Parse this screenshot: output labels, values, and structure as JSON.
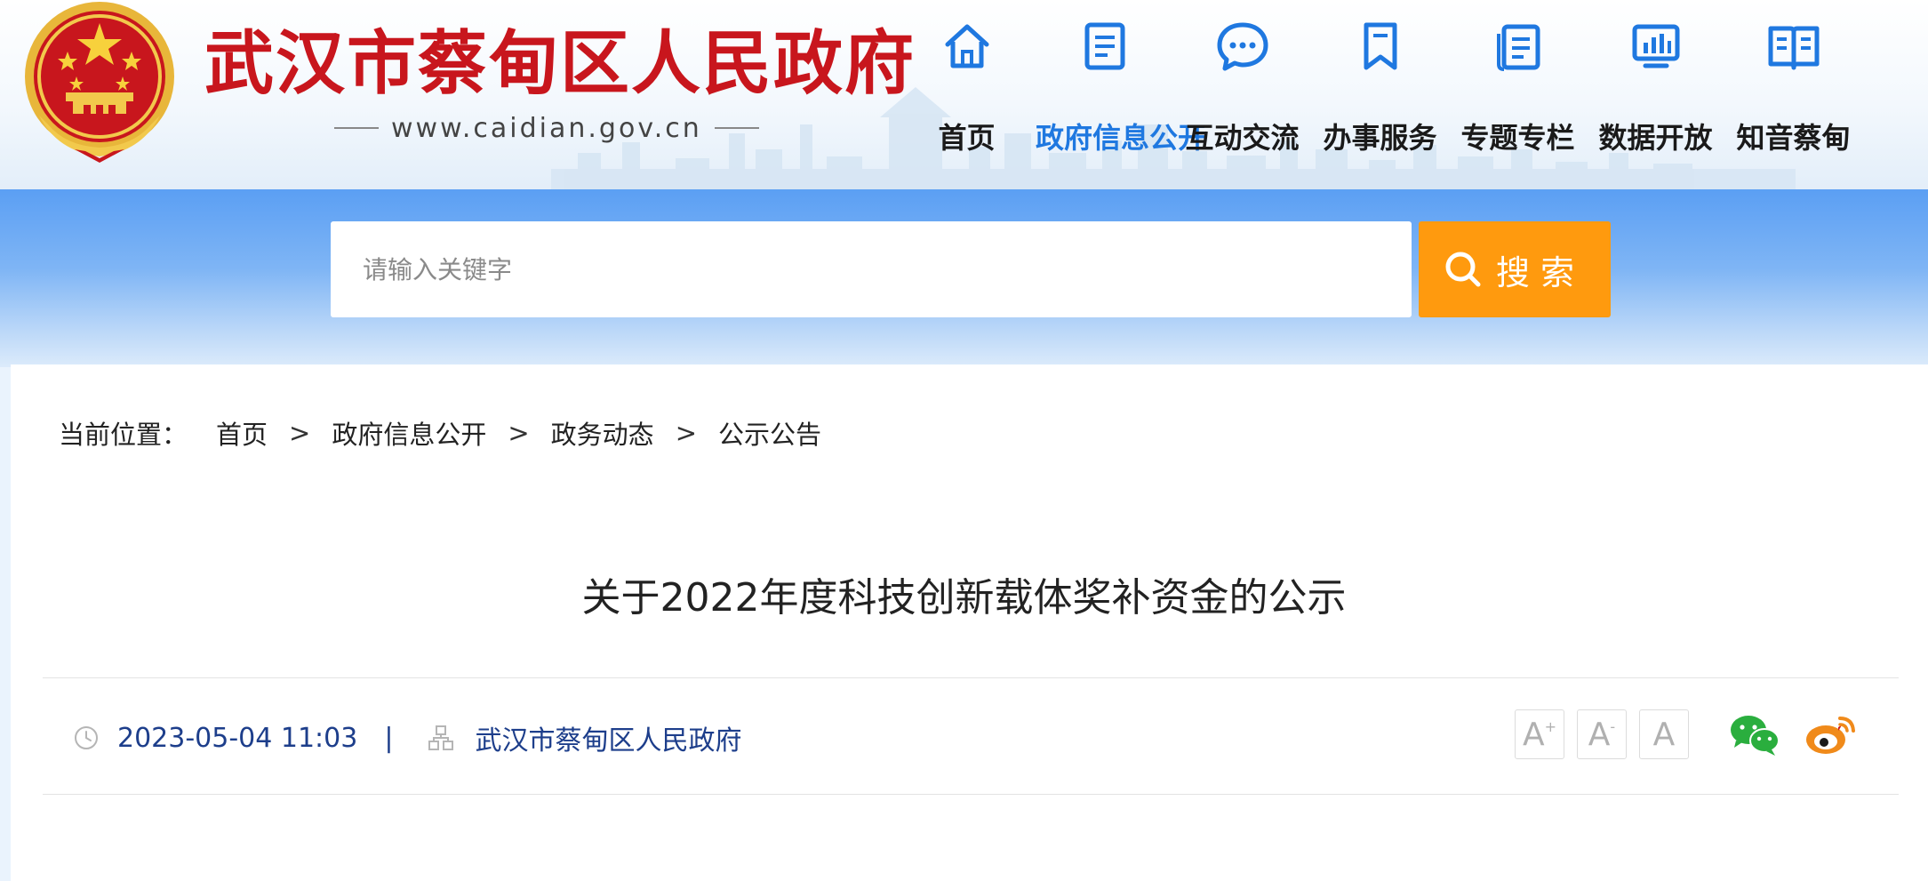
{
  "site": {
    "title": "武汉市蔡甸区人民政府",
    "url": "www.caidian.gov.cn"
  },
  "nav": [
    {
      "label": "首页",
      "icon": "home-icon"
    },
    {
      "label": "政府信息公开",
      "icon": "document-icon",
      "active": true
    },
    {
      "label": "互动交流",
      "icon": "chat-bubble-icon"
    },
    {
      "label": "办事服务",
      "icon": "bookmark-icon"
    },
    {
      "label": "专题专栏",
      "icon": "clipboard-icon"
    },
    {
      "label": "数据开放",
      "icon": "bar-chart-icon"
    },
    {
      "label": "知音蔡甸",
      "icon": "open-book-icon"
    }
  ],
  "search": {
    "placeholder": "请输入关键字",
    "button_label": "搜索"
  },
  "breadcrumb": {
    "prefix": "当前位置：",
    "items": [
      "首页",
      "政府信息公开",
      "政务动态",
      "公示公告"
    ],
    "separator": ">"
  },
  "article": {
    "title": "关于2022年度科技创新载体奖补资金的公示",
    "datetime": "2023-05-04 11:03",
    "separator": "|",
    "source": "武汉市蔡甸区人民政府"
  },
  "font_controls": {
    "increase": "A",
    "decrease": "A",
    "reset": "A"
  },
  "share": {
    "wechat": "wechat-icon",
    "weibo": "weibo-icon"
  },
  "colors": {
    "title_red": "#c8161d",
    "nav_active": "#1f78e0",
    "search_button": "#ff9a0e",
    "meta_text": "#1d3e8b"
  }
}
